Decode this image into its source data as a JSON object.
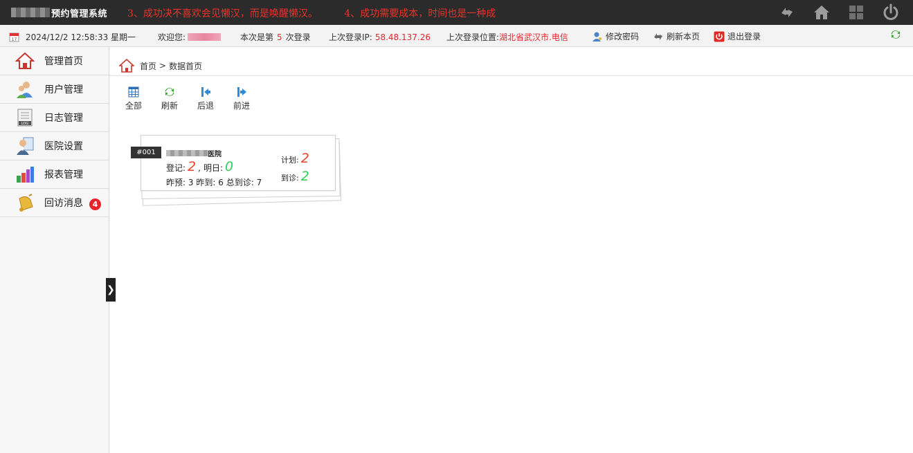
{
  "header": {
    "app_title": "预约管理系统",
    "marquee": [
      "3、成功决不喜欢会见懒汉，而是唤醒懒汉。",
      "4、成功需要成本，时间也是一种成"
    ]
  },
  "infobar": {
    "datetime": "2024/12/2 12:58:33 星期一",
    "welcome_label": "欢迎您:",
    "login_prefix": "本次是第",
    "login_count": "5",
    "login_suffix": "次登录",
    "last_ip_label": "上次登录IP:",
    "last_ip": "58.48.137.26",
    "last_location_label": "上次登录位置:",
    "last_location": "湖北省武汉市.电信",
    "change_password": "修改密码",
    "refresh_page": "刷新本页",
    "logout": "退出登录"
  },
  "sidebar": {
    "items": [
      {
        "label": "管理首页",
        "icon": "home-icon"
      },
      {
        "label": "用户管理",
        "icon": "users-icon"
      },
      {
        "label": "日志管理",
        "icon": "log-icon"
      },
      {
        "label": "医院设置",
        "icon": "doctor-icon"
      },
      {
        "label": "报表管理",
        "icon": "bar-chart-icon"
      },
      {
        "label": "回访消息",
        "icon": "bell-icon",
        "badge": "4"
      }
    ],
    "toggle": "❯"
  },
  "breadcrumb": {
    "home": "首页",
    "separator": ">",
    "current": "数据首页"
  },
  "toolbar": {
    "all": "全部",
    "refresh": "刷新",
    "back": "后退",
    "forward": "前进"
  },
  "card": {
    "tag": "#001",
    "hospital_suffix": "医院",
    "registered_label": "登记:",
    "registered": "2",
    "tomorrow_label": "明日:",
    "tomorrow": "0",
    "yesterday_booked_label": "昨预:",
    "yesterday_booked": "3",
    "yesterday_arrived_label": "昨到:",
    "yesterday_arrived": "6",
    "total_arrived_label": "总到诊:",
    "total_arrived": "7",
    "plan_label": "计划:",
    "plan": "2",
    "arrived_label": "到诊:",
    "arrived": "2"
  },
  "colors": {
    "accent_red": "#e3262b",
    "green": "#2fd05a",
    "topbar": "#2b2b2b"
  }
}
